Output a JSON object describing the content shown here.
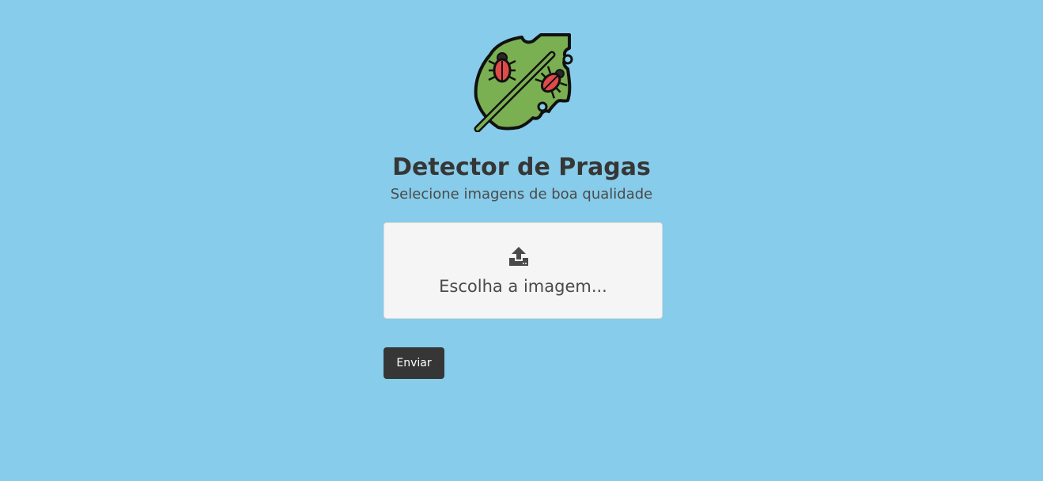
{
  "header": {
    "logo_icon": "leaf-with-bugs-icon",
    "title": "Detector de Pragas",
    "subtitle": "Selecione imagens de boa qualidade"
  },
  "upload": {
    "icon": "upload-icon",
    "label": "Escolha a imagem..."
  },
  "form": {
    "submit_label": "Enviar"
  },
  "colors": {
    "background": "#87CCEA",
    "leaf": "#7AB051",
    "bug": "#E04A4A",
    "button": "#363636",
    "upload_box": "#F5F5F5"
  }
}
